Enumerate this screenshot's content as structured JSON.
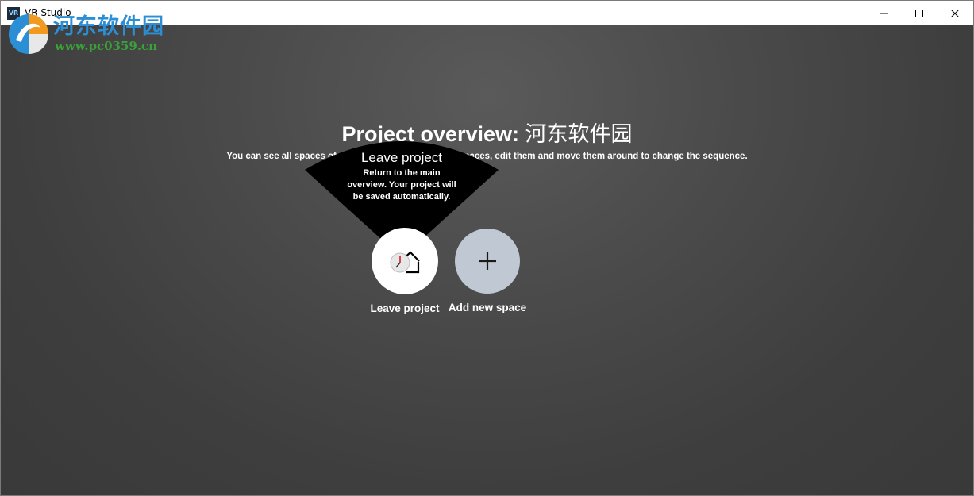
{
  "window": {
    "title": "VR Studio",
    "icon_text": "VR"
  },
  "watermark": {
    "site_name": "河东软件园",
    "url": "www.pc0359.cn"
  },
  "overview": {
    "title_bold": "Project overview:",
    "title_name": "河东软件园",
    "subtitle": "You can see all spaces of your project here. Add new spaces, edit them and move them around to change the sequence."
  },
  "tooltip": {
    "title": "Leave project",
    "text": "Return to the main overview. Your project will be saved automatically."
  },
  "actions": {
    "leave_label": "Leave project",
    "add_label": "Add new space",
    "leave_icon": "home-clock-icon",
    "add_icon": "plus-icon"
  },
  "colors": {
    "background": "#3e3e3e",
    "add_circle": "#c0c8d3",
    "watermark_blue": "#2c8fd6",
    "watermark_green": "#3aa03a"
  }
}
